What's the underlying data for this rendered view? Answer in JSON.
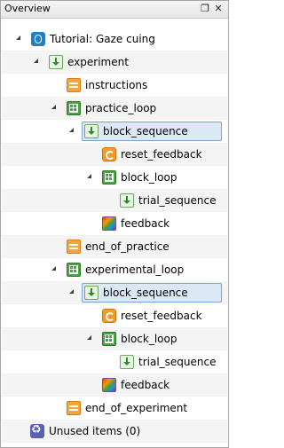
{
  "panel": {
    "title": "Overview",
    "float_glyph": "❐",
    "close_glyph": "✕"
  },
  "tree": [
    {
      "label": "Tutorial: Gaze cuing",
      "icon": "experiment-root-icon",
      "type": "os",
      "depth": 0,
      "expanded": true,
      "selected": false
    },
    {
      "label": "experiment",
      "icon": "sequence-icon",
      "type": "seq",
      "depth": 1,
      "expanded": true,
      "selected": false
    },
    {
      "label": "instructions",
      "icon": "sketchpad-icon",
      "type": "sketch",
      "depth": 2,
      "expanded": null,
      "selected": false
    },
    {
      "label": "practice_loop",
      "icon": "loop-icon",
      "type": "loop",
      "depth": 2,
      "expanded": true,
      "selected": false
    },
    {
      "label": "block_sequence",
      "icon": "sequence-icon",
      "type": "seq",
      "depth": 3,
      "expanded": true,
      "selected": true
    },
    {
      "label": "reset_feedback",
      "icon": "reset-feedback-icon",
      "type": "reset",
      "depth": 4,
      "expanded": null,
      "selected": false
    },
    {
      "label": "block_loop",
      "icon": "loop-icon",
      "type": "loop",
      "depth": 4,
      "expanded": true,
      "selected": false
    },
    {
      "label": "trial_sequence",
      "icon": "sequence-icon",
      "type": "seq",
      "depth": 5,
      "expanded": null,
      "selected": false
    },
    {
      "label": "feedback",
      "icon": "feedback-icon",
      "type": "fb",
      "depth": 4,
      "expanded": null,
      "selected": false
    },
    {
      "label": "end_of_practice",
      "icon": "sketchpad-icon",
      "type": "sketch",
      "depth": 2,
      "expanded": null,
      "selected": false
    },
    {
      "label": "experimental_loop",
      "icon": "loop-icon",
      "type": "loop",
      "depth": 2,
      "expanded": true,
      "selected": false
    },
    {
      "label": "block_sequence",
      "icon": "sequence-icon",
      "type": "seq",
      "depth": 3,
      "expanded": true,
      "selected": true
    },
    {
      "label": "reset_feedback",
      "icon": "reset-feedback-icon",
      "type": "reset",
      "depth": 4,
      "expanded": null,
      "selected": false
    },
    {
      "label": "block_loop",
      "icon": "loop-icon",
      "type": "loop",
      "depth": 4,
      "expanded": true,
      "selected": false
    },
    {
      "label": "trial_sequence",
      "icon": "sequence-icon",
      "type": "seq",
      "depth": 5,
      "expanded": null,
      "selected": false
    },
    {
      "label": "feedback",
      "icon": "feedback-icon",
      "type": "fb",
      "depth": 4,
      "expanded": null,
      "selected": false
    },
    {
      "label": "end_of_experiment",
      "icon": "sketchpad-icon",
      "type": "sketch",
      "depth": 2,
      "expanded": null,
      "selected": false
    },
    {
      "label": "Unused items (0)",
      "icon": "unused-items-icon",
      "type": "unused",
      "depth": 0,
      "expanded": null,
      "selected": false
    }
  ],
  "colors": {
    "selection_bg": "#dde8f6",
    "selection_border": "#7da2ce",
    "alt_row": "#f4f4f4"
  }
}
